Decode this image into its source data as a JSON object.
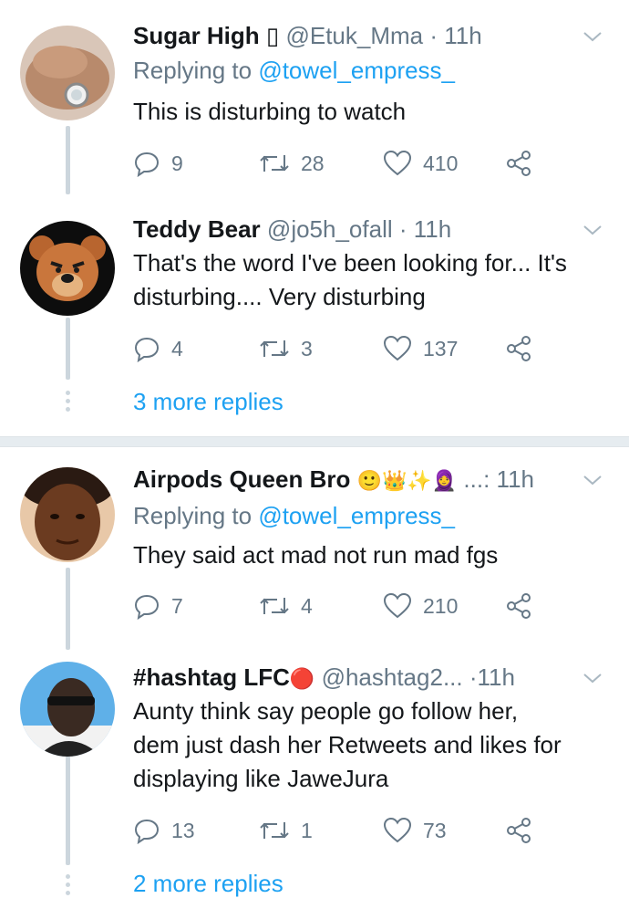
{
  "thread1": {
    "tweets": [
      {
        "name": "Sugar High",
        "name_glyph": "▯",
        "handle": "@Etuk_Mma",
        "time": "11h",
        "replying_prefix": "Replying to ",
        "replying_to": "@towel_empress_",
        "text": "This is disturbing to watch",
        "reply_count": "9",
        "retweet_count": "28",
        "like_count": "410"
      },
      {
        "name": "Teddy Bear",
        "handle": "@jo5h_ofall",
        "time": "11h",
        "text_line1": "That's the word I've been looking for... It's",
        "text_line2": "disturbing.... Very disturbing",
        "reply_count": "4",
        "retweet_count": "3",
        "like_count": "137"
      }
    ],
    "more_replies": "3 more replies"
  },
  "thread2": {
    "tweets": [
      {
        "name": "Airpods Queen Bro",
        "name_emojis": "🙂👑✨🧕",
        "ellipsis": "...:",
        "time": "11h",
        "replying_prefix": "Replying to ",
        "replying_to": "@towel_empress_",
        "text": "They said act mad not run mad fgs",
        "reply_count": "7",
        "retweet_count": "4",
        "like_count": "210"
      },
      {
        "name": "#hashtag LFC",
        "name_emoji": "🔴",
        "handle": "@hashtag2...",
        "time": "11h",
        "text_line1": "Aunty think say people go follow her,",
        "text_line2": "dem just dash her Retweets and likes for",
        "text_line3": "displaying like JaweJura",
        "reply_count": "13",
        "retweet_count": "1",
        "like_count": "73"
      }
    ],
    "more_replies": "2 more replies"
  },
  "colors": {
    "accent": "#1da1f2",
    "secondary_text": "#657786",
    "thread_line": "#ccd6dd",
    "divider": "#e6ecf0"
  },
  "icons": {
    "reply": "reply-icon",
    "retweet": "retweet-icon",
    "like": "heart-icon",
    "share": "share-icon",
    "menu": "chevron-down-icon"
  }
}
